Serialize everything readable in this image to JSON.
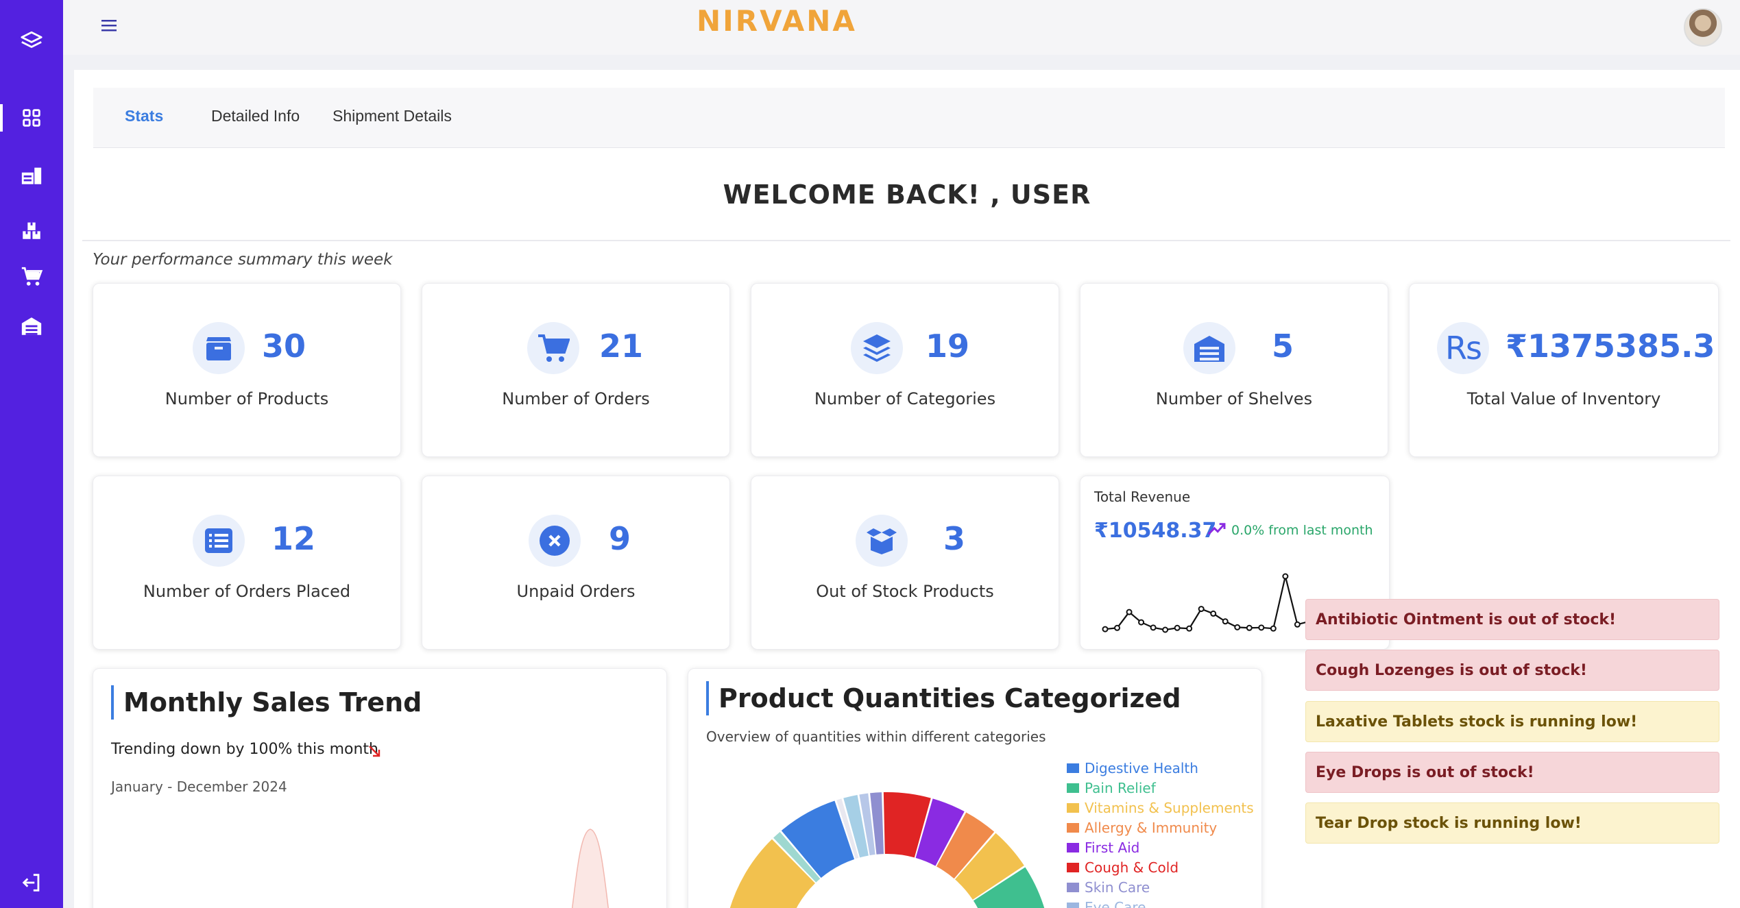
{
  "app": {
    "brand": "NIRVANA"
  },
  "sidebar": {
    "items": [
      {
        "icon": "layers-icon"
      },
      {
        "icon": "dashboard-grid-icon"
      },
      {
        "icon": "warehouse-icon"
      },
      {
        "icon": "boxes-icon"
      },
      {
        "icon": "cart-icon"
      },
      {
        "icon": "shelves-icon"
      },
      {
        "icon": "logout-icon"
      }
    ]
  },
  "tabs": [
    {
      "label": "Stats",
      "active": true
    },
    {
      "label": "Detailed Info",
      "active": false
    },
    {
      "label": "Shipment Details",
      "active": false
    }
  ],
  "welcome": "WELCOME BACK! , USER",
  "summary": "Your performance summary this week",
  "stats": [
    {
      "value": "30",
      "label": "Number of Products",
      "icon": "box-icon"
    },
    {
      "value": "21",
      "label": "Number of Orders",
      "icon": "cart-icon"
    },
    {
      "value": "19",
      "label": "Number of Categories",
      "icon": "layers-icon"
    },
    {
      "value": "5",
      "label": "Number of Shelves",
      "icon": "shelves-icon"
    },
    {
      "value": "₹1375385.3",
      "label": "Total Value of Inventory",
      "icon": "rupee-icon",
      "icon_text": "Rs"
    },
    {
      "value": "12",
      "label": "Number of Orders Placed",
      "icon": "list-icon"
    },
    {
      "value": "9",
      "label": "Unpaid Orders",
      "icon": "x-circle-icon"
    },
    {
      "value": "3",
      "label": "Out of Stock Products",
      "icon": "open-box-icon"
    }
  ],
  "revenue": {
    "title": "Total Revenue",
    "value": "₹10548.37",
    "change": "0.0% from last month",
    "sparkline": [
      2,
      2.4,
      7.5,
      4.2,
      2.5,
      1.8,
      2.4,
      2.2,
      8.5,
      7,
      4.5,
      2.6,
      2.4,
      2.5,
      2.2,
      19,
      3.5,
      4.5,
      3.2,
      6.5,
      7.5,
      5
    ]
  },
  "sales_trend": {
    "title": "Monthly Sales Trend",
    "subtitle": "Trending down by 100% this month",
    "range": "January - December 2024"
  },
  "categories_chart": {
    "title": "Product Quantities Categorized",
    "subtitle": "Overview of quantities within different categories"
  },
  "chart_data": {
    "type": "pie",
    "title": "Product Quantities Categorized",
    "legend": [
      {
        "name": "Digestive Health",
        "color": "#3b7de0"
      },
      {
        "name": "Pain Relief",
        "color": "#3fbf8f"
      },
      {
        "name": "Vitamins & Supplements",
        "color": "#f2c14e"
      },
      {
        "name": "Allergy & Immunity",
        "color": "#f08a4b"
      },
      {
        "name": "First Aid",
        "color": "#8a2be2"
      },
      {
        "name": "Cough & Cold",
        "color": "#e02424"
      },
      {
        "name": "Skin Care",
        "color": "#8f8fd0"
      },
      {
        "name": "Eye Care",
        "color": "#9bb6e0"
      }
    ],
    "visible_segments": [
      {
        "color": "#f2c14e",
        "value": 10
      },
      {
        "color": "#9fd8d0",
        "value": 1.2
      },
      {
        "color": "#3b7de0",
        "value": 7
      },
      {
        "color": "#e8e8f0",
        "value": 0.8
      },
      {
        "color": "#a6cfe6",
        "value": 1.8
      },
      {
        "color": "#b7c7e8",
        "value": 1.2
      },
      {
        "color": "#8f8fd0",
        "value": 1.5
      },
      {
        "color": "#e02424",
        "value": 5.5
      },
      {
        "color": "#8a2be2",
        "value": 4
      },
      {
        "color": "#f08a4b",
        "value": 4
      },
      {
        "color": "#f2c14e",
        "value": 5
      },
      {
        "color": "#3fbf8f",
        "value": 6
      }
    ]
  },
  "alerts": [
    {
      "text": "Antibiotic Ointment is out of stock!",
      "kind": "out"
    },
    {
      "text": "Cough Lozenges is out of stock!",
      "kind": "out"
    },
    {
      "text": "Laxative Tablets stock is running low!",
      "kind": "low"
    },
    {
      "text": "Eye Drops is out of stock!",
      "kind": "out"
    },
    {
      "text": "Tear Drop stock is running low!",
      "kind": "low"
    }
  ],
  "colors": {
    "sidebar": "#5321e0",
    "accent": "#3b6fe0",
    "brand": "#f0a43a",
    "positive": "#2aa66a",
    "negative": "#e02424"
  }
}
